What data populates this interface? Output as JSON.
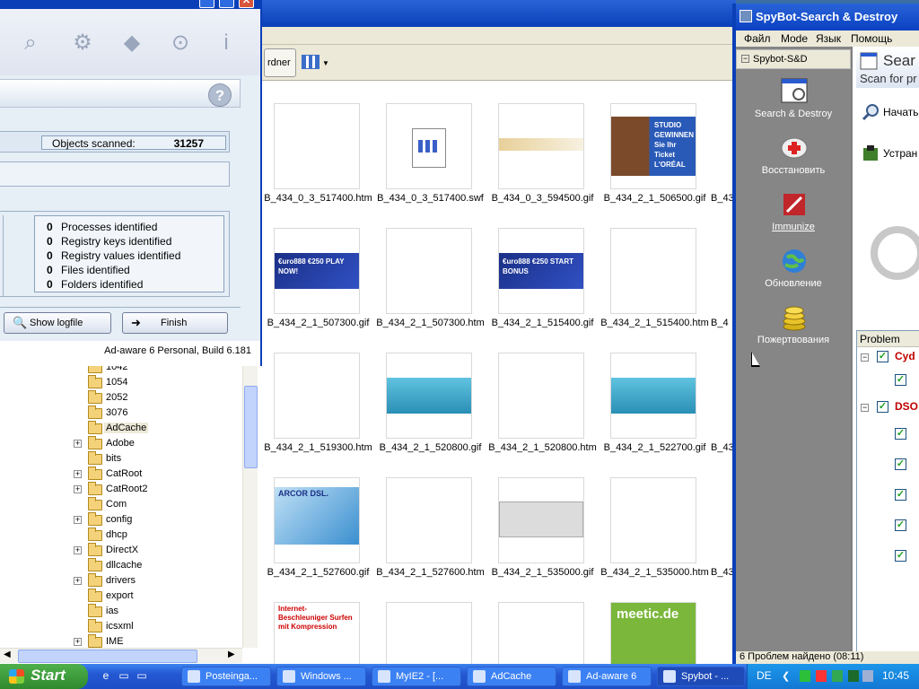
{
  "explorer": {
    "address_button": "rdner",
    "tree": [
      {
        "label": "1042",
        "expandable": false
      },
      {
        "label": "1054",
        "expandable": false
      },
      {
        "label": "2052",
        "expandable": false
      },
      {
        "label": "3076",
        "expandable": false
      },
      {
        "label": "AdCache",
        "expandable": false,
        "selected": true
      },
      {
        "label": "Adobe",
        "expandable": true
      },
      {
        "label": "bits",
        "expandable": false
      },
      {
        "label": "CatRoot",
        "expandable": true
      },
      {
        "label": "CatRoot2",
        "expandable": true
      },
      {
        "label": "Com",
        "expandable": false
      },
      {
        "label": "config",
        "expandable": true
      },
      {
        "label": "dhcp",
        "expandable": false
      },
      {
        "label": "DirectX",
        "expandable": true
      },
      {
        "label": "dllcache",
        "expandable": false
      },
      {
        "label": "drivers",
        "expandable": true
      },
      {
        "label": "export",
        "expandable": false
      },
      {
        "label": "ias",
        "expandable": false
      },
      {
        "label": "icsxml",
        "expandable": false
      },
      {
        "label": "IME",
        "expandable": true
      }
    ],
    "thumbnails": [
      {
        "name": "B_434_0_3_517400.htm",
        "art": "none"
      },
      {
        "name": "B_434_0_3_517400.swf",
        "art": "swf"
      },
      {
        "name": "B_434_0_3_594500.gif",
        "art": "banner"
      },
      {
        "name": "B_434_2_1_506500.gif",
        "art": "studio",
        "text": "STUDIO GEWINNEN Sie Ihr Ticket L'ORÉAL"
      },
      {
        "name": "B_434_2_1_507300.gif",
        "art": "euro",
        "text": "€uro888 €250 PLAY NOW!"
      },
      {
        "name": "B_434_2_1_507300.htm",
        "art": "none"
      },
      {
        "name": "B_434_2_1_515400.gif",
        "art": "euro",
        "text": "€uro888 €250 START BONUS"
      },
      {
        "name": "B_434_2_1_515400.htm",
        "art": "none"
      },
      {
        "name": "B_434_2_1_519300.htm",
        "art": "none"
      },
      {
        "name": "B_434_2_1_520800.gif",
        "art": "phone"
      },
      {
        "name": "B_434_2_1_520800.htm",
        "art": "none"
      },
      {
        "name": "B_434_2_1_522700.gif",
        "art": "phone"
      },
      {
        "name": "B_434_2_1_527600.gif",
        "art": "dsl",
        "text": "ARCOR DSL."
      },
      {
        "name": "B_434_2_1_527600.htm",
        "art": "none"
      },
      {
        "name": "B_434_2_1_535000.gif",
        "art": "screen"
      },
      {
        "name": "B_434_2_1_535000.htm",
        "art": "none"
      },
      {
        "name": "",
        "art": "inet",
        "text": "Internet-Beschleuniger Surfen mit Kompression"
      },
      {
        "name": "",
        "art": "none"
      },
      {
        "name": "",
        "art": "none"
      },
      {
        "name": "",
        "art": "meetic",
        "text": "meetic.de"
      }
    ],
    "partial_names": [
      "B_43",
      "B_4",
      "B_43",
      "B_43"
    ]
  },
  "adaware": {
    "objects_scanned_label": "Objects scanned:",
    "objects_scanned_value": "31257",
    "results": [
      {
        "count": "0",
        "label": "Processes identified"
      },
      {
        "count": "0",
        "label": "Registry keys identified"
      },
      {
        "count": "0",
        "label": "Registry values identified"
      },
      {
        "count": "0",
        "label": "Files identified"
      },
      {
        "count": "0",
        "label": "Folders identified"
      }
    ],
    "show_logfile": "Show logfile",
    "finish": "Finish",
    "build": "Ad-aware 6 Personal, Build 6.181",
    "help_glyph": "?",
    "close_glyph": "✕"
  },
  "spybot": {
    "title": "SpyBot-Search & Destroy",
    "menu": [
      "Файл",
      "Mode",
      "Язык",
      "Помощь"
    ],
    "tree_root": "Spybot-S&D",
    "nav": [
      {
        "label": "Search & Destroy"
      },
      {
        "label": "Восстановить"
      },
      {
        "label": "Immunize"
      },
      {
        "label": "Обновление"
      },
      {
        "label": "Пожертвования"
      }
    ],
    "header_title": "Sear",
    "header_sub": "Scan for pr",
    "action_start": "Начать",
    "action_fix": "Устран",
    "list_header": "Problem",
    "groups": [
      "Cyd",
      "DSO"
    ],
    "status": "6 Проблем найдено (08:11)"
  },
  "taskbar": {
    "start": "Start",
    "buttons": [
      {
        "label": "Posteinga..."
      },
      {
        "label": "Windows ..."
      },
      {
        "label": "MyIE2 - [..."
      },
      {
        "label": "AdCache"
      },
      {
        "label": "Ad-aware 6"
      },
      {
        "label": "Spybot - ..."
      }
    ],
    "lang": "DE",
    "clock": "10:45"
  }
}
